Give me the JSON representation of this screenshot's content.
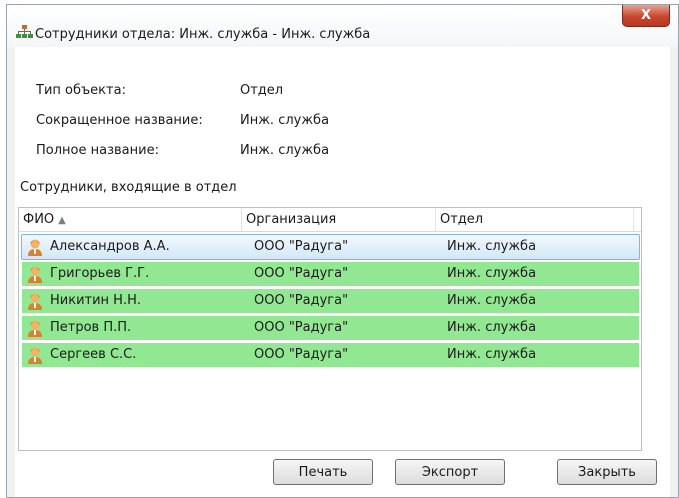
{
  "window": {
    "title": "Сотрудники отдела: Инж. служба - Инж. служба",
    "close_label": "X"
  },
  "info": [
    {
      "label": "Тип объекта:",
      "value": "Отдел"
    },
    {
      "label": "Сокращенное название:",
      "value": "Инж. служба"
    },
    {
      "label": "Полное название:",
      "value": "Инж. служба"
    }
  ],
  "section_label": "Сотрудники, входящие в отдел",
  "grid": {
    "columns": [
      "ФИО",
      "Организация",
      "Отдел"
    ],
    "sort_indicator": "▲",
    "rows": [
      {
        "name": "Александров А.А.",
        "org": "ООО \"Радуга\"",
        "dept": "Инж. служба",
        "selected": true
      },
      {
        "name": "Григорьев Г.Г.",
        "org": "ООО \"Радуга\"",
        "dept": "Инж. служба"
      },
      {
        "name": "Никитин Н.Н.",
        "org": "ООО \"Радуга\"",
        "dept": "Инж. служба"
      },
      {
        "name": "Петров П.П.",
        "org": "ООО \"Радуга\"",
        "dept": "Инж. служба"
      },
      {
        "name": "Сергеев С.С.",
        "org": "ООО \"Радуга\"",
        "dept": "Инж. служба"
      }
    ]
  },
  "buttons": {
    "print": "Печать",
    "export": "Экспорт",
    "close": "Закрыть"
  },
  "colors": {
    "row_highlight": "#92e892",
    "selected_row": "#d3e7f8",
    "close_button": "#c8472f"
  }
}
